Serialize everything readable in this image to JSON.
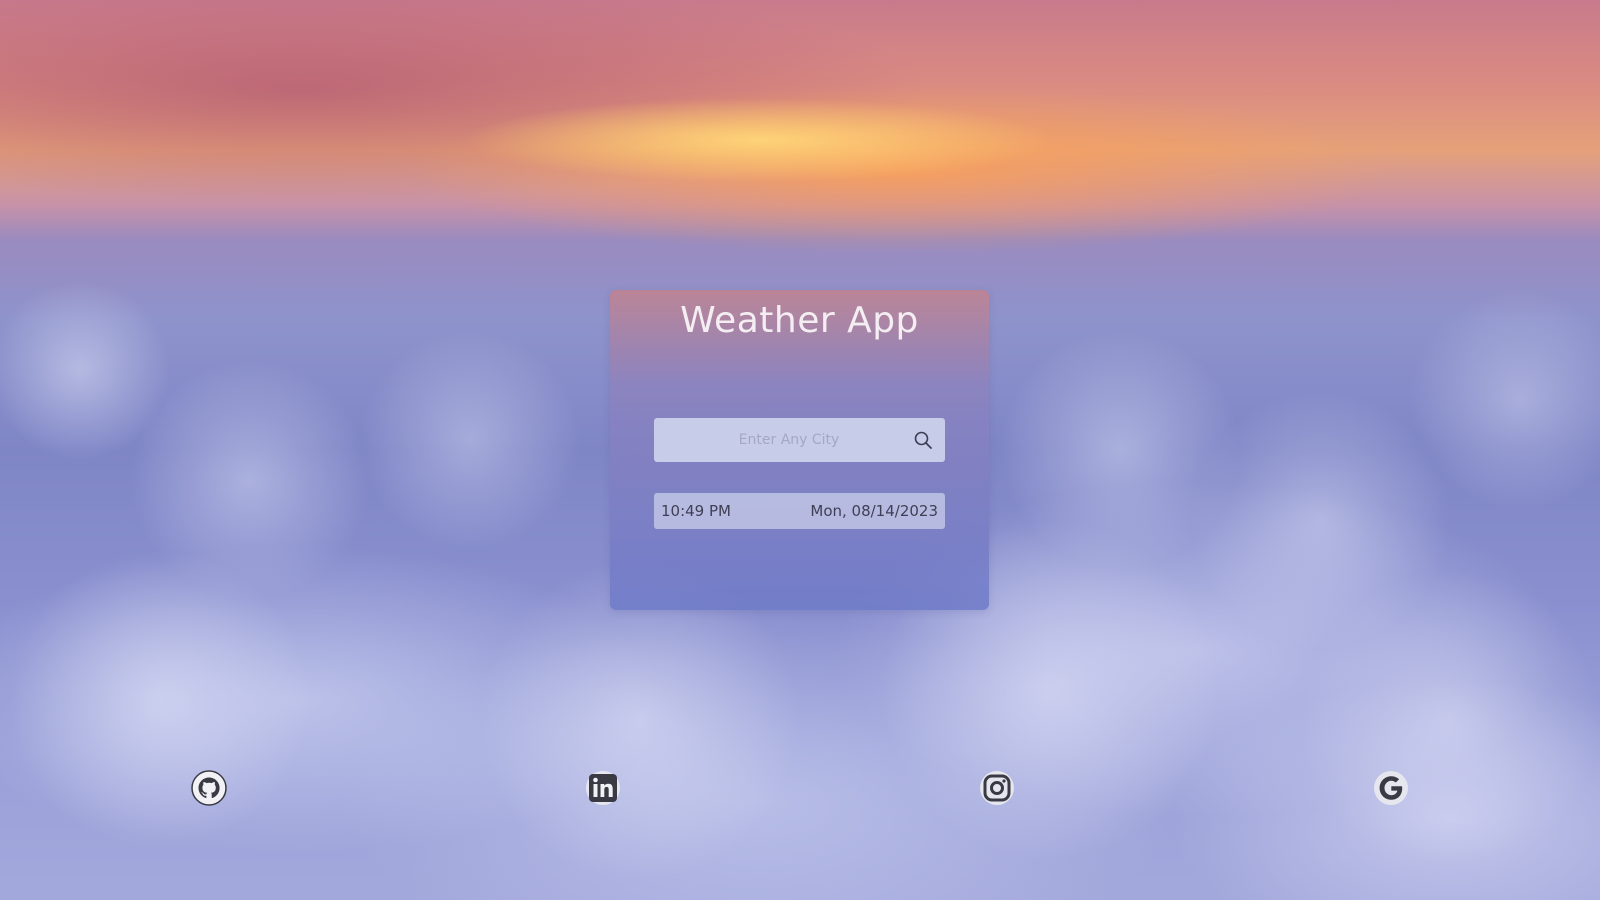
{
  "app": {
    "title": "Weather App"
  },
  "search": {
    "placeholder": "Enter Any City",
    "value": ""
  },
  "datetime": {
    "time": "10:49 PM",
    "date": "Mon, 08/14/2023"
  },
  "social_links": [
    {
      "icon": "github-icon"
    },
    {
      "icon": "linkedin-icon"
    },
    {
      "icon": "instagram-icon"
    },
    {
      "icon": "google-icon"
    }
  ],
  "colors": {
    "card_top": "#c4828c",
    "card_bottom": "#6e7ac8",
    "title_text": "#f4eef2",
    "input_bg": "#cdd2ec",
    "icon_color": "#3a3a44"
  }
}
